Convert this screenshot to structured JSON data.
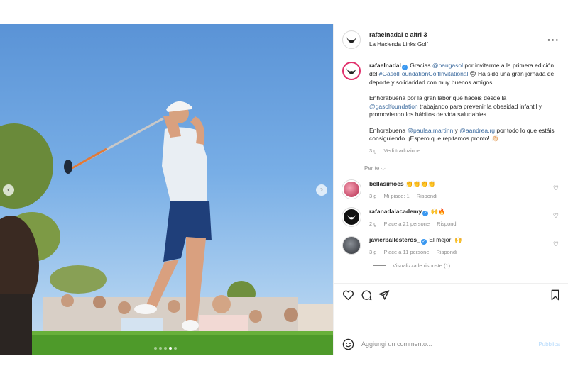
{
  "post": {
    "user": "rafaelnadal e altri 3",
    "location": "La Hacienda Links Golf",
    "more_icon": "more-icon"
  },
  "caption": {
    "username": "rafaelnadal",
    "p1_a": " Gracias ",
    "p1_mention": "@paugasol",
    "p1_b": " por invitarme a la primera edición del ",
    "p1_hashtag": "#GasolFoundationGolfInvitational",
    "p1_c": " 😊 Ha sido una gran jornada de deporte y solidaridad con muy buenos amigos.",
    "p2_a": "Enhorabuena por la gran labor que hacéis desde la ",
    "p2_mention": "@gasolfoundation",
    "p2_b": " trabajando para prevenir la obesidad infantil y promoviendo los hábitos de vida saludables.",
    "p3_a": "Enhorabuena ",
    "p3_mention1": "@paulaa.martinn",
    "p3_b": " y ",
    "p3_mention2": "@aandrea.rg",
    "p3_c": " por todo lo que estáis consiguiendo. ¡Espero que repitamos pronto! 👏🏻",
    "time": "3 g",
    "translate": "Vedi traduzione"
  },
  "for_you": "Per te ⌵",
  "comments": [
    {
      "user": "bellasimoes",
      "text": " 👏👏👏👏",
      "time": "3 g",
      "likes": "Mi piace: 1",
      "reply": "Rispondi"
    },
    {
      "user": "rafanadalacademy",
      "text": " 🙌🔥",
      "time": "2 g",
      "likes": "Piace a 21 persone",
      "reply": "Rispondi"
    },
    {
      "user": "javierballesteros_",
      "text": " El mejor! 🙌",
      "time": "3 g",
      "likes": "Piace a 11 persone",
      "reply": "Rispondi"
    }
  ],
  "view_replies": "Visualizza le risposte (1)",
  "add_comment": {
    "placeholder": "Aggiungi un commento...",
    "publish": "Pubblica"
  },
  "colors": {
    "link": "#3b6a9e",
    "publish_disabled": "#b9dcfc",
    "verified": "#3897f0"
  }
}
